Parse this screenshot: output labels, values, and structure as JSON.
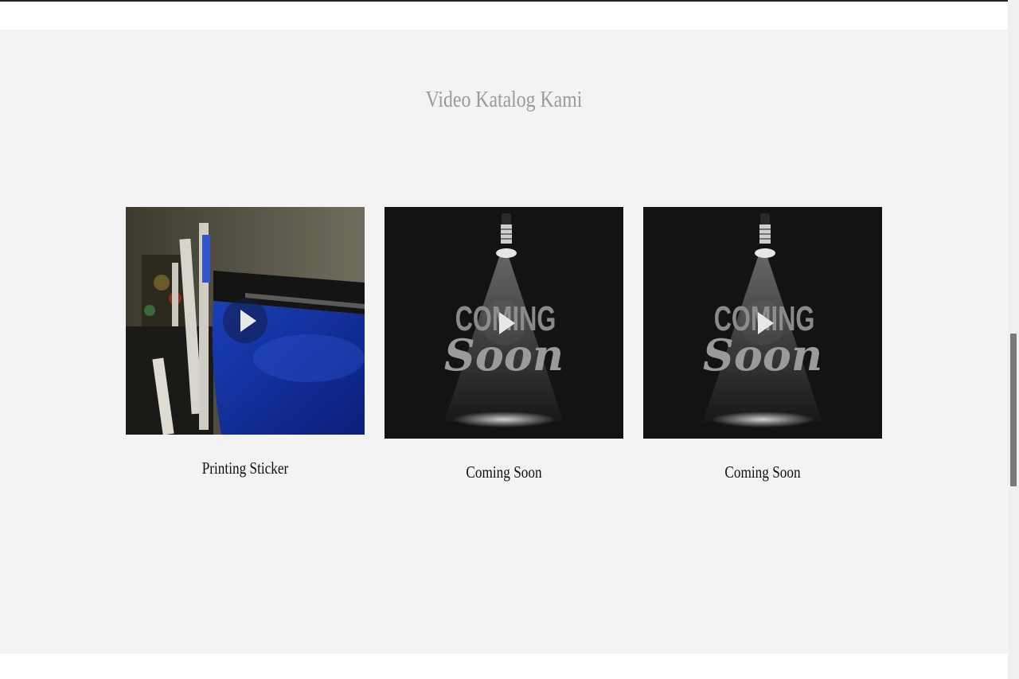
{
  "section": {
    "title": "Video Katalog Kami"
  },
  "videos": [
    {
      "caption": "Printing Sticker",
      "thumbnail": "printing-machine-photo"
    },
    {
      "caption": "Coming Soon",
      "thumbnail": "coming-soon-spotlight",
      "overlay_text": "COMING Soon"
    },
    {
      "caption": "Coming Soon",
      "thumbnail": "coming-soon-spotlight",
      "overlay_text": "COMING Soon"
    }
  ],
  "icons": {
    "play": "play-icon",
    "carousel_prev": "chevron-left-icon",
    "carousel_next": "chevron-right-icon"
  },
  "colors": {
    "section_bg": "#f3f3f3",
    "title": "#9a9a9a",
    "caption": "#111111"
  }
}
